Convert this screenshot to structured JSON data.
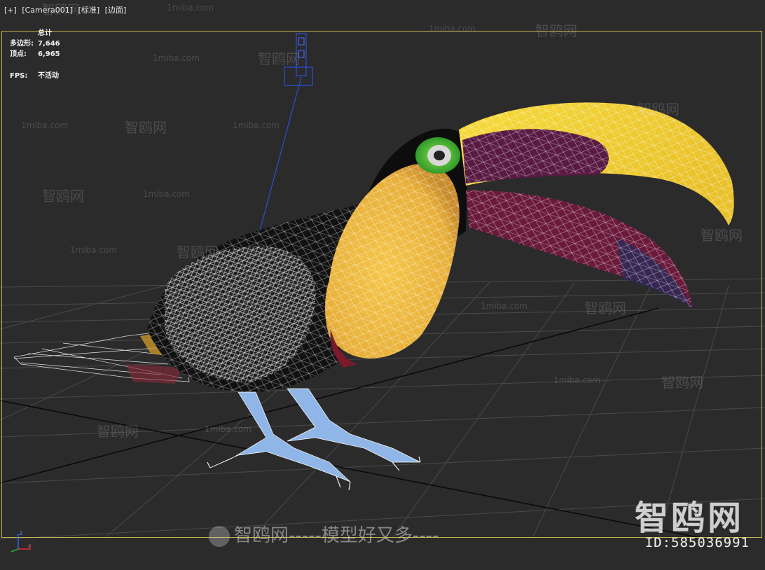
{
  "viewport": {
    "labels": [
      "[+]",
      "[Camera001]",
      "[标准]",
      "[边面]"
    ],
    "stats": {
      "title": "总计",
      "polygons_label": "多边形:",
      "polygons_value": "7,646",
      "vertices_label": "顶点:",
      "vertices_value": "6,965",
      "fps_label": "FPS:",
      "fps_value": "不活动"
    },
    "axis": {
      "x": "x",
      "z": "z"
    }
  },
  "watermarks": {
    "site": "1miba.com",
    "brand": "智鸥网",
    "dashes": "------",
    "big": "智鸥网",
    "bottom": "智鸥网-----模型好又多----",
    "id": "ID:585036991"
  },
  "colors": {
    "viewport_bg": "#2b2b2b",
    "frame": "#c9b44a",
    "beak_yellow": "#f2d338",
    "beak_maroon": "#6a1a3a",
    "chest_yellow": "#f0c040",
    "body_black": "#111111",
    "eye_green": "#5cc03a",
    "feet_blue": "#8fb6e6",
    "wire": "#ffffff",
    "camera_blue": "#2a50e0"
  }
}
